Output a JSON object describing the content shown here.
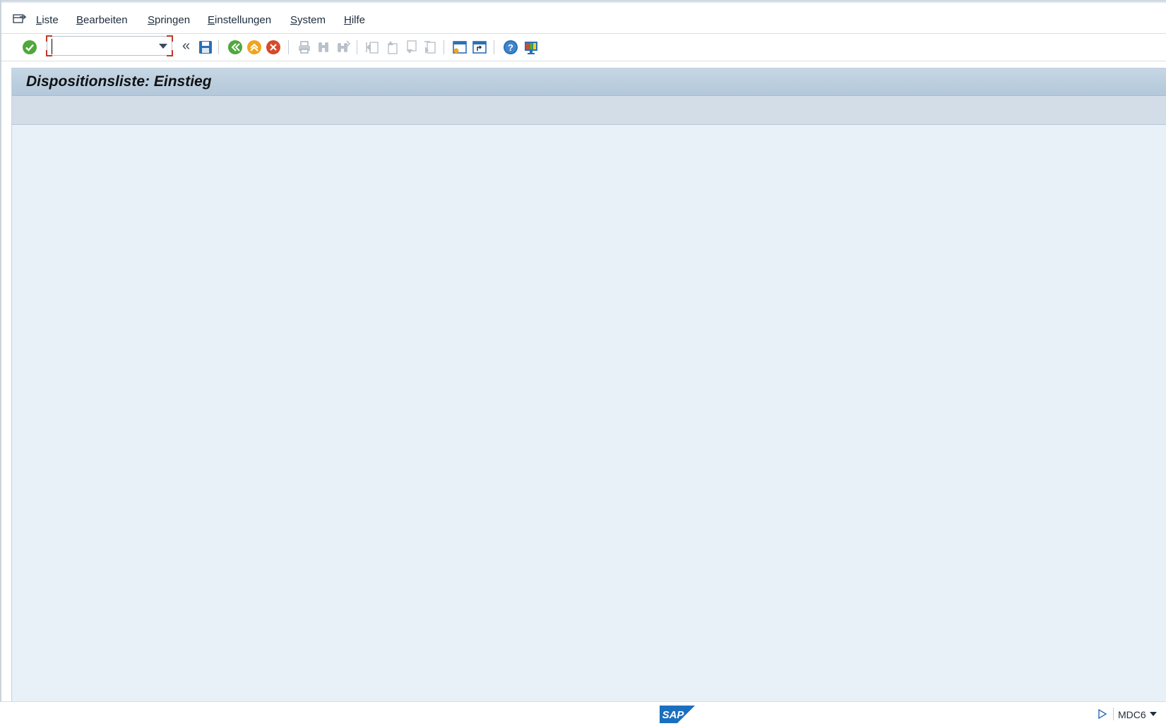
{
  "menu": {
    "items": [
      {
        "mnemonic": "L",
        "rest": "iste"
      },
      {
        "mnemonic": "B",
        "rest": "earbeiten"
      },
      {
        "mnemonic": "S",
        "rest": "pringen"
      },
      {
        "mnemonic": "E",
        "rest": "instellungen"
      },
      {
        "mnemonic": "S",
        "rest": "ystem"
      },
      {
        "mnemonic": "H",
        "rest": "ilfe"
      }
    ]
  },
  "toolbar": {
    "command_field_value": "",
    "collapse_symbol": "«",
    "icons": [
      "enter-icon",
      "save-icon",
      "back-icon",
      "exit-icon",
      "cancel-icon",
      "print-icon",
      "find-icon",
      "find-next-icon",
      "first-page-icon",
      "previous-page-icon",
      "next-page-icon",
      "last-page-icon",
      "create-session-icon",
      "create-shortcut-icon",
      "help-icon",
      "customize-layout-icon"
    ]
  },
  "screen": {
    "title": "Dispositionsliste: Einstieg"
  },
  "status": {
    "transaction_code": "MDC6",
    "logo": "SAP"
  },
  "colors": {
    "title_bar": "#b3c8da",
    "content_bg": "#e8f0f8",
    "enter_green": "#4ea83a",
    "exit_orange": "#f0a41e",
    "cancel_red": "#d64a2b",
    "sap_blue": "#1b6fc0"
  }
}
